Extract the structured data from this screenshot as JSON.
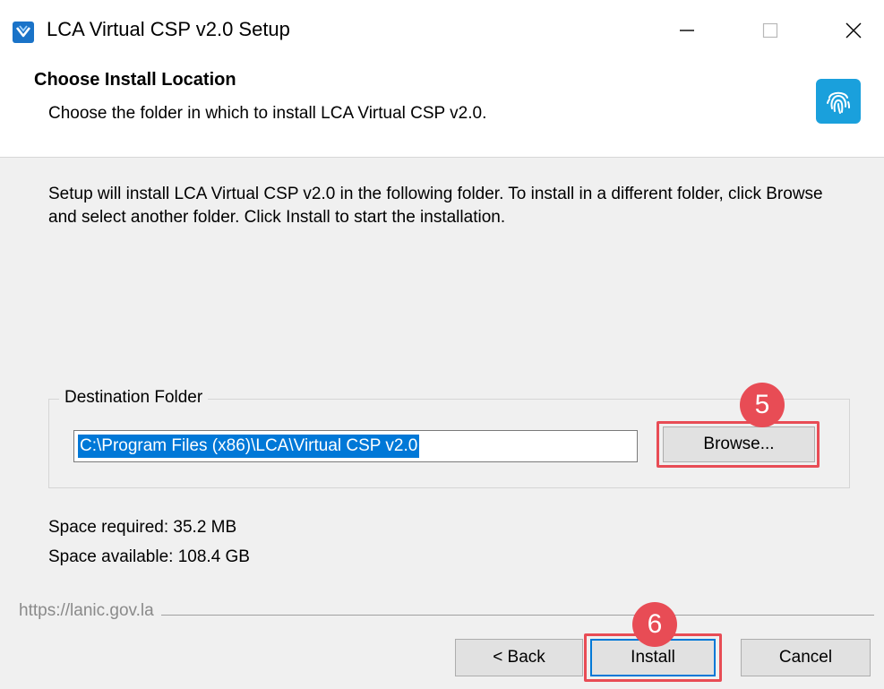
{
  "window": {
    "title": "LCA Virtual CSP v2.0 Setup",
    "controls": [
      "minimize-icon",
      "maximize-icon",
      "close-icon"
    ]
  },
  "header": {
    "title": "Choose Install Location",
    "subtitle": "Choose the folder in which to install LCA Virtual CSP v2.0.",
    "icon": "fingerprint-icon"
  },
  "body": {
    "description": "Setup will install LCA Virtual CSP v2.0 in the following folder. To install in a different folder, click Browse and select another folder. Click Install to start the installation.",
    "destination": {
      "legend": "Destination Folder",
      "path": "C:\\Program Files (x86)\\LCA\\Virtual CSP v2.0",
      "browse_label": "Browse..."
    },
    "space_required": "Space required: 35.2 MB",
    "space_available": "Space available: 108.4 GB"
  },
  "footer": {
    "branding": "https://lanic.gov.la",
    "back_label": "< Back",
    "install_label": "Install",
    "cancel_label": "Cancel"
  },
  "annotations": {
    "step_browse": "5",
    "step_install": "6",
    "highlight_color": "#e84c55"
  },
  "colors": {
    "selection": "#0078d7",
    "header_icon_bg": "#1aa0dc",
    "dialog_bg": "#f0f0f0"
  }
}
